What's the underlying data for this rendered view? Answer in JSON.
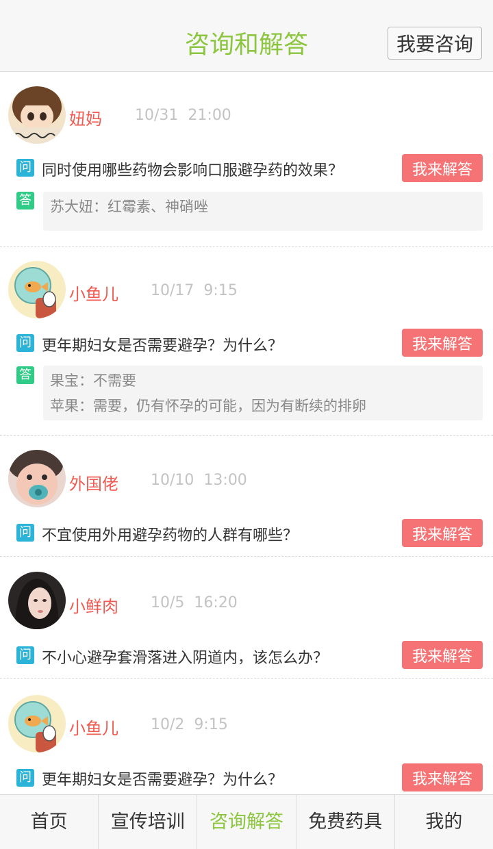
{
  "header": {
    "title": "咨询和解答",
    "ask_button": "我要咨询"
  },
  "question_icon": "问",
  "answer_icon": "答",
  "reply_button": "我来解答",
  "posts": [
    {
      "user": "妞妈",
      "date": "10/31",
      "time": "21:00",
      "avatar": "cartoon-girl-avatar",
      "question": "同时使用哪些药物会影响口服避孕药的效果？",
      "answers": [
        "苏大妞：红霉素、神硝唑"
      ]
    },
    {
      "user": "小鱼儿",
      "date": "10/17",
      "time": "9:15",
      "avatar": "goldfish-bowl-avatar",
      "question": "更年期妇女是否需要避孕？为什么？",
      "answers": [
        "果宝：不需要",
        "苹果：需要，仍有怀孕的可能，因为有断续的排卵"
      ]
    },
    {
      "user": "外国佬",
      "date": "10/10",
      "time": "13:00",
      "avatar": "baby-pacifier-avatar",
      "question": "不宜使用外用避孕药物的人群有哪些？",
      "answers": []
    },
    {
      "user": "小鲜肉",
      "date": "10/5",
      "time": "16:20",
      "avatar": "woman-portrait-avatar",
      "question": "不小心避孕套滑落进入阴道内，该怎么办？",
      "answers": []
    },
    {
      "user": "小鱼儿",
      "date": "10/2",
      "time": "9:15",
      "avatar": "goldfish-bowl-avatar",
      "question": "更年期妇女是否需要避孕？为什么？",
      "answers": []
    }
  ],
  "tabs": [
    {
      "label": "首页",
      "active": false
    },
    {
      "label": "宣传培训",
      "active": false
    },
    {
      "label": "咨询解答",
      "active": true
    },
    {
      "label": "免费药具",
      "active": false
    },
    {
      "label": "我的",
      "active": false
    }
  ],
  "colors": {
    "accent": "#8cc63f",
    "username": "#f05a50",
    "reply_button": "#f57374",
    "question_icon": "#2cb4d8",
    "answer_icon": "#2fcb87"
  }
}
